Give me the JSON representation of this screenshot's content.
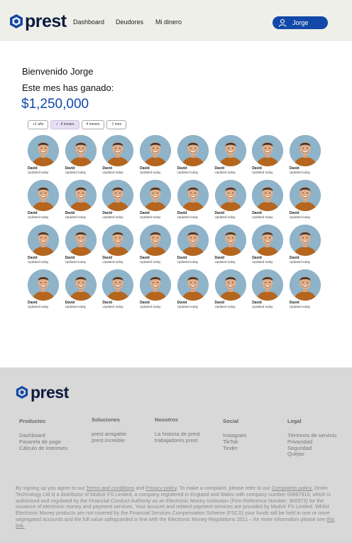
{
  "brand": {
    "name": "prest",
    "icon": "hexagon-logo-icon"
  },
  "colors": {
    "accent": "#1248a8",
    "header_bg": "#efefea",
    "footer_bg": "#d8d8d8",
    "brand_dark": "#0d1b3d"
  },
  "nav": {
    "items": [
      "Dashboard",
      "Deudores",
      "Mi dinero"
    ]
  },
  "user": {
    "name": "Jorge",
    "icon": "user-icon"
  },
  "main": {
    "welcome": "Bienvenido Jorge",
    "earned_label": "Este mes has ganado:",
    "amount": "$1,250,000"
  },
  "filters": [
    {
      "label": "+1 año",
      "active": false
    },
    {
      "label": "6 meses",
      "active": true
    },
    {
      "label": "4 meses",
      "active": false
    },
    {
      "label": "1 mes",
      "active": false
    }
  ],
  "debtors": [
    {
      "name": "David",
      "status": "Updated today"
    },
    {
      "name": "David",
      "status": "Updated today"
    },
    {
      "name": "David",
      "status": "Updated today"
    },
    {
      "name": "David",
      "status": "Updated today"
    },
    {
      "name": "David",
      "status": "Updated today"
    },
    {
      "name": "David",
      "status": "Updated today"
    },
    {
      "name": "David",
      "status": "Updated today"
    },
    {
      "name": "David",
      "status": "Updated today"
    },
    {
      "name": "David",
      "status": "Updated today"
    },
    {
      "name": "David",
      "status": "Updated today"
    },
    {
      "name": "David",
      "status": "Updated today"
    },
    {
      "name": "David",
      "status": "Updated today"
    },
    {
      "name": "David",
      "status": "Updated today"
    },
    {
      "name": "David",
      "status": "Updated today"
    },
    {
      "name": "David",
      "status": "Updated today"
    },
    {
      "name": "David",
      "status": "Updated today"
    },
    {
      "name": "David",
      "status": "Updated today"
    },
    {
      "name": "David",
      "status": "Updated today"
    },
    {
      "name": "David",
      "status": "Updated today"
    },
    {
      "name": "David",
      "status": "Updated today"
    },
    {
      "name": "David",
      "status": "Updated today"
    },
    {
      "name": "David",
      "status": "Updated today"
    },
    {
      "name": "David",
      "status": "Updated today"
    },
    {
      "name": "David",
      "status": "Updated today"
    },
    {
      "name": "David",
      "status": "Updated today"
    },
    {
      "name": "David",
      "status": "Updated today"
    },
    {
      "name": "David",
      "status": "Updated today"
    },
    {
      "name": "David",
      "status": "Updated today"
    },
    {
      "name": "David",
      "status": "Updated today"
    },
    {
      "name": "David",
      "status": "Updated today"
    },
    {
      "name": "David",
      "status": "Updated today"
    },
    {
      "name": "David",
      "status": "Updated today"
    }
  ],
  "footer": {
    "columns": [
      {
        "title": "Productos",
        "links": [
          "Dashboard",
          "Pasarela de pago",
          "Cálculo de intereses"
        ]
      },
      {
        "title": "Soluciones",
        "links": [
          "prest amigable",
          "prest increible"
        ]
      },
      {
        "title": "Nosotros",
        "links": [
          "La historia de prest",
          "trabajadores prest"
        ]
      },
      {
        "title": "Social",
        "links": [
          "Instagram",
          "TikTok",
          "Tinder"
        ]
      },
      {
        "title": "Legal",
        "links": [
          "Términos de servicio",
          "Privacidad",
          "Seguridad",
          "Quejas"
        ]
      }
    ],
    "legal": {
      "p1": "By signing up you agree to our ",
      "terms": "Terms and conditions",
      "and": " and ",
      "privacy": "Privacy policy",
      "p2": ". To make a complaint, please refer to our ",
      "complaints": "Complaints policy.",
      "p3": " Omim Technology Ltd is a distributor of Modulr FS Limited, a company registered in England and Wales with company number 09897919, which is authorised and regulated by the Financial Conduct Authority as an Electronic Money Institution (Firm Reference Number: 900573) for the issuance of electronic money and payment services. Your account and related payment services are provided by Modulr FS Limited. Whilst Electronic Money products are not covered by the Financial Services Compensation Scheme (FSCS) your funds will be held in one or more segregated accounts and the full value safeguarded in line with the Electronic Money Regulations 2011 – for more information please see ",
      "this_link": "this link."
    }
  }
}
